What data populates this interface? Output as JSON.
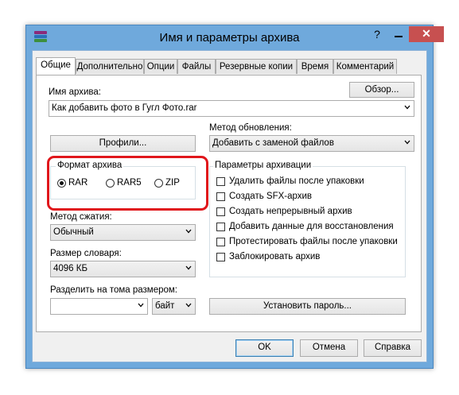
{
  "window": {
    "title": "Имя и параметры архива",
    "help_glyph": "?",
    "close_glyph": "✕"
  },
  "tabs": [
    "Общие",
    "Дополнительно",
    "Опции",
    "Файлы",
    "Резервные копии",
    "Время",
    "Комментарий"
  ],
  "archive_name": {
    "label": "Имя архива:",
    "value": "Как добавить фото в Гугл Фото.rar",
    "browse_label": "Обзор..."
  },
  "profiles_label": "Профили...",
  "update_method": {
    "label": "Метод обновления:",
    "value": "Добавить с заменой файлов"
  },
  "archive_format": {
    "label": "Формат архива",
    "options": [
      "RAR",
      "RAR5",
      "ZIP"
    ],
    "selected": "RAR"
  },
  "compression_method": {
    "label": "Метод сжатия:",
    "value": "Обычный"
  },
  "dictionary_size": {
    "label": "Размер словаря:",
    "value": "4096 КБ"
  },
  "split_volumes": {
    "label": "Разделить на тома размером:",
    "value": "",
    "unit": "байт"
  },
  "archive_options": {
    "label": "Параметры архивации",
    "items": [
      "Удалить файлы после упаковки",
      "Создать SFX-архив",
      "Создать непрерывный архив",
      "Добавить данные для восстановления",
      "Протестировать файлы после упаковки",
      "Заблокировать архив"
    ]
  },
  "set_password_label": "Установить пароль...",
  "footer": {
    "ok": "OK",
    "cancel": "Отмена",
    "help": "Справка"
  },
  "colors": {
    "titlebar": "#6fa9dc",
    "close": "#c75050",
    "highlight": "#e0161b"
  }
}
